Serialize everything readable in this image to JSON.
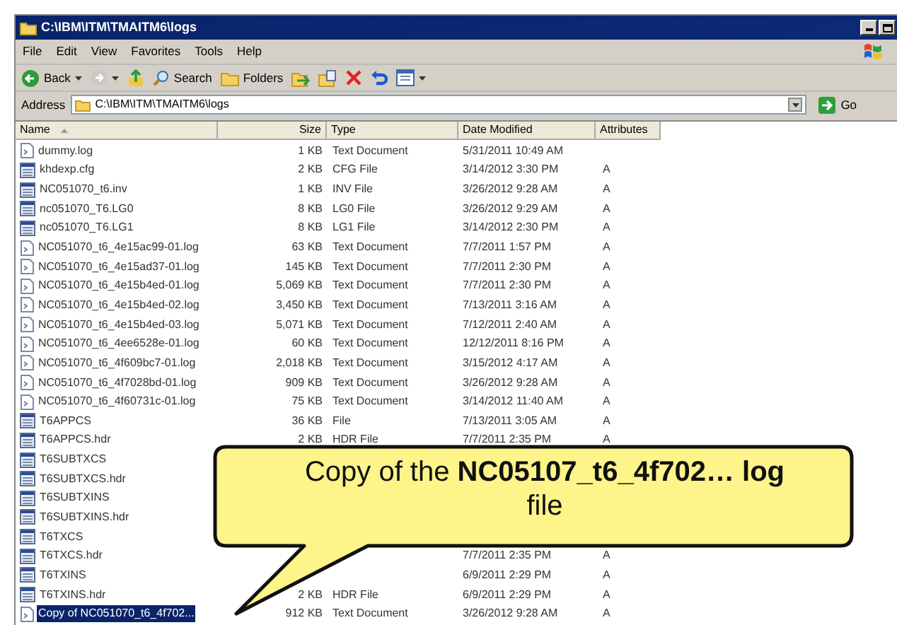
{
  "window": {
    "title": "C:\\IBM\\ITM\\TMAITM6\\logs"
  },
  "menu": [
    "File",
    "Edit",
    "View",
    "Favorites",
    "Tools",
    "Help"
  ],
  "toolbar": [
    {
      "kind": "back",
      "label": "Back"
    },
    {
      "kind": "forward"
    },
    {
      "kind": "up"
    },
    {
      "kind": "search",
      "label": "Search"
    },
    {
      "kind": "folders",
      "label": "Folders"
    },
    {
      "kind": "move"
    },
    {
      "kind": "copy"
    },
    {
      "kind": "delete"
    },
    {
      "kind": "undo"
    },
    {
      "kind": "views"
    }
  ],
  "address": {
    "label": "Address",
    "value": "C:\\IBM\\ITM\\TMAITM6\\logs",
    "go": "Go"
  },
  "table": {
    "columns": [
      "Name",
      "Size",
      "Type",
      "Date Modified",
      "Attributes"
    ],
    "rows": [
      {
        "kind": "text",
        "name": "dummy.log",
        "size": "1 KB",
        "type": "Text Document",
        "date": "5/31/2011 10:49 AM",
        "selected": false
      },
      {
        "kind": "data",
        "name": "khdexp.cfg",
        "size": "2 KB",
        "type": "CFG File",
        "date": "3/14/2012 3:30 PM",
        "attr": "A",
        "selected": false
      },
      {
        "kind": "data",
        "name": "NC051070_t6.inv",
        "size": "1 KB",
        "type": "INV File",
        "date": "3/26/2012 9:28 AM",
        "attr": "A",
        "selected": false
      },
      {
        "kind": "data",
        "name": "nc051070_T6.LG0",
        "size": "8 KB",
        "type": "LG0 File",
        "date": "3/26/2012 9:29 AM",
        "attr": "A",
        "selected": false
      },
      {
        "kind": "data",
        "name": "nc051070_T6.LG1",
        "size": "8 KB",
        "type": "LG1 File",
        "date": "3/14/2012 2:30 PM",
        "attr": "A",
        "selected": false
      },
      {
        "kind": "text",
        "name": "NC051070_t6_4e15ac99-01.log",
        "size": "63 KB",
        "type": "Text Document",
        "date": "7/7/2011 1:57 PM",
        "attr": "A",
        "selected": false
      },
      {
        "kind": "text",
        "name": "NC051070_t6_4e15ad37-01.log",
        "size": "145 KB",
        "type": "Text Document",
        "date": "7/7/2011 2:30 PM",
        "attr": "A",
        "selected": false
      },
      {
        "kind": "text",
        "name": "NC051070_t6_4e15b4ed-01.log",
        "size": "5,069 KB",
        "type": "Text Document",
        "date": "7/7/2011 2:30 PM",
        "attr": "A",
        "selected": false
      },
      {
        "kind": "text",
        "name": "NC051070_t6_4e15b4ed-02.log",
        "size": "3,450 KB",
        "type": "Text Document",
        "date": "7/13/2011 3:16 AM",
        "attr": "A",
        "selected": false
      },
      {
        "kind": "text",
        "name": "NC051070_t6_4e15b4ed-03.log",
        "size": "5,071 KB",
        "type": "Text Document",
        "date": "7/12/2011 2:40 AM",
        "attr": "A",
        "selected": false
      },
      {
        "kind": "text",
        "name": "NC051070_t6_4ee6528e-01.log",
        "size": "60 KB",
        "type": "Text Document",
        "date": "12/12/2011 8:16 PM",
        "attr": "A",
        "selected": false
      },
      {
        "kind": "text",
        "name": "NC051070_t6_4f609bc7-01.log",
        "size": "2,018 KB",
        "type": "Text Document",
        "date": "3/15/2012 4:17 AM",
        "attr": "A",
        "selected": false
      },
      {
        "kind": "text",
        "name": "NC051070_t6_4f7028bd-01.log",
        "size": "909 KB",
        "type": "Text Document",
        "date": "3/26/2012 9:28 AM",
        "attr": "A",
        "selected": false
      },
      {
        "kind": "text",
        "name": "NC051070_t6_4f60731c-01.log",
        "size": "75 KB",
        "type": "Text Document",
        "date": "3/14/2012 11:40 AM",
        "attr": "A",
        "selected": false
      },
      {
        "kind": "data",
        "name": "T6APPCS",
        "size": "36 KB",
        "type": "File",
        "date": "7/13/2011 3:05 AM",
        "attr": "A",
        "selected": false
      },
      {
        "kind": "data",
        "name": "T6APPCS.hdr",
        "size": "2 KB",
        "type": "HDR File",
        "date": "7/7/2011 2:35 PM",
        "attr": "A",
        "selected": false
      },
      {
        "kind": "data",
        "name": "T6SUBTXCS",
        "selected": false
      },
      {
        "kind": "data",
        "name": "T6SUBTXCS.hdr",
        "selected": false
      },
      {
        "kind": "data",
        "name": "T6SUBTXINS",
        "selected": false
      },
      {
        "kind": "data",
        "name": "T6SUBTXINS.hdr",
        "selected": false
      },
      {
        "kind": "data",
        "name": "T6TXCS",
        "selected": false
      },
      {
        "kind": "data",
        "name": "T6TXCS.hdr",
        "date": "7/7/2011 2:35 PM",
        "attr": "A",
        "selected": false
      },
      {
        "kind": "data",
        "name": "T6TXINS",
        "date": "6/9/2011 2:29 PM",
        "attr": "A",
        "selected": false
      },
      {
        "kind": "data",
        "name": "T6TXINS.hdr",
        "size": "2 KB",
        "type": "HDR File",
        "date": "6/9/2011 2:29 PM",
        "attr": "A",
        "selected": false
      },
      {
        "kind": "text",
        "name": "Copy of NC051070_t6_4f702...",
        "size": "912 KB",
        "type": "Text Document",
        "date": "3/26/2012 9:28 AM",
        "attr": "A",
        "selected": true
      }
    ]
  },
  "callout": {
    "text": "Copy of the **NC05107_t6_4f702… log** file"
  }
}
